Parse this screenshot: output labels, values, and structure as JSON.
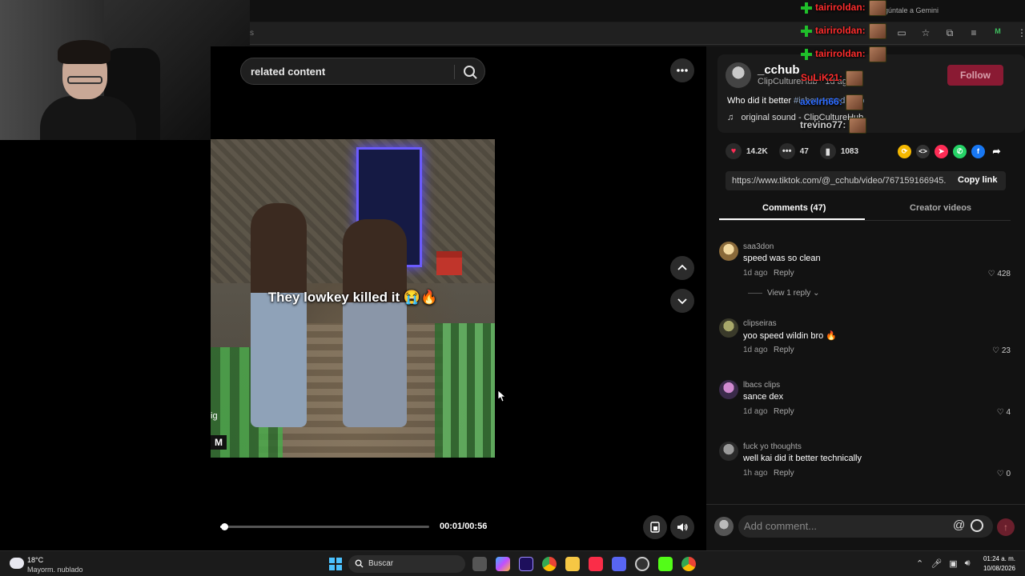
{
  "browser": {
    "address_fragment": "s",
    "gemini_prompt": "Pregúntale a Gemini"
  },
  "search": {
    "placeholder_text": "related content"
  },
  "video": {
    "caption": "They lowkey killed it 😭🔥",
    "watermark_1": "ig",
    "watermark_2": "M",
    "current_time": "00:01/00:56",
    "progress_fraction": 0.018
  },
  "post": {
    "username": "_cchub",
    "display_name": "ClipCultureHub",
    "posted": "1d ago",
    "follow_label": "Follow",
    "description_text": "Who did it better",
    "description_tags": "#ishowspeed #fyp",
    "sound": "original sound - ClipCultureHub",
    "likes": "14.2K",
    "comments": "47",
    "saves": "1083",
    "link_url": "https://www.tiktok.com/@_cchub/video/767159166945...",
    "copy_label": "Copy link"
  },
  "tabs": {
    "comments": "Comments (47)",
    "creator_videos": "Creator videos"
  },
  "comments": [
    {
      "user": "saa3don",
      "text": "speed was so clean",
      "time": "1d ago",
      "reply": "Reply",
      "likes": "428"
    },
    {
      "user": "clipseiras",
      "text": "yoo speed wildin bro 🔥",
      "time": "1d ago",
      "reply": "Reply",
      "likes": "23"
    },
    {
      "user": "lbacs clips",
      "text": "sance dex",
      "time": "1d ago",
      "reply": "Reply",
      "likes": "4"
    },
    {
      "user": "fuck yo thoughts",
      "text": "well kai did it better technically",
      "time": "1h ago",
      "reply": "Reply",
      "likes": "0"
    }
  ],
  "view_reply": "View 1 reply",
  "add_comment": {
    "placeholder": "Add comment...",
    "at": "@"
  },
  "chat": [
    {
      "user": "tairiroldan:",
      "color": "#ff2d2d"
    },
    {
      "user": "tairiroldan:",
      "color": "#ff2d2d"
    },
    {
      "user": "tairiroldan:",
      "color": "#ff2d2d"
    },
    {
      "user": "SuLiK21:",
      "color": "#ff2d2d"
    },
    {
      "user": "axelrh66:",
      "color": "#2d6bff"
    },
    {
      "user": "trevino77:",
      "color": "#cfcfcf"
    }
  ],
  "taskbar": {
    "temperature": "18°C",
    "weather": "Mayorm. nublado",
    "search_label": "Buscar",
    "time": "01:24 a. m.",
    "date": "10/08/2026"
  },
  "colors": {
    "follow": "#8a1a33",
    "like_heart": "#fe2c55",
    "accent_blue": "#4cc2ff"
  }
}
